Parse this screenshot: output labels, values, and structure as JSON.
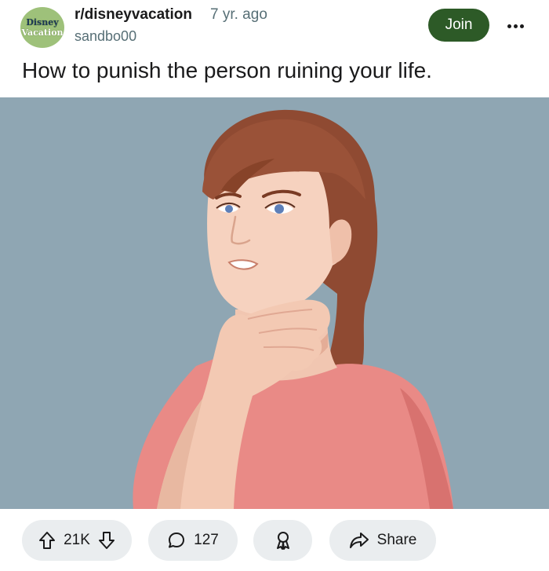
{
  "post": {
    "subreddit_avatar_text": [
      "Disney",
      "Vacation"
    ],
    "subreddit": "r/disneyvacation",
    "age": "7 yr. ago",
    "author": "sandbo00",
    "join_label": "Join",
    "title": "How to punish the person ruining your life."
  },
  "actions": {
    "votes": "21K",
    "comments": "127",
    "share_label": "Share"
  },
  "colors": {
    "join_button": "#2d5a27",
    "pill_background": "#eaedef",
    "image_background": "#8fa6b3",
    "shirt": "#e98a86"
  },
  "icons": [
    "upvote-icon",
    "downvote-icon",
    "comment-icon",
    "award-icon",
    "share-icon",
    "more-icon"
  ]
}
